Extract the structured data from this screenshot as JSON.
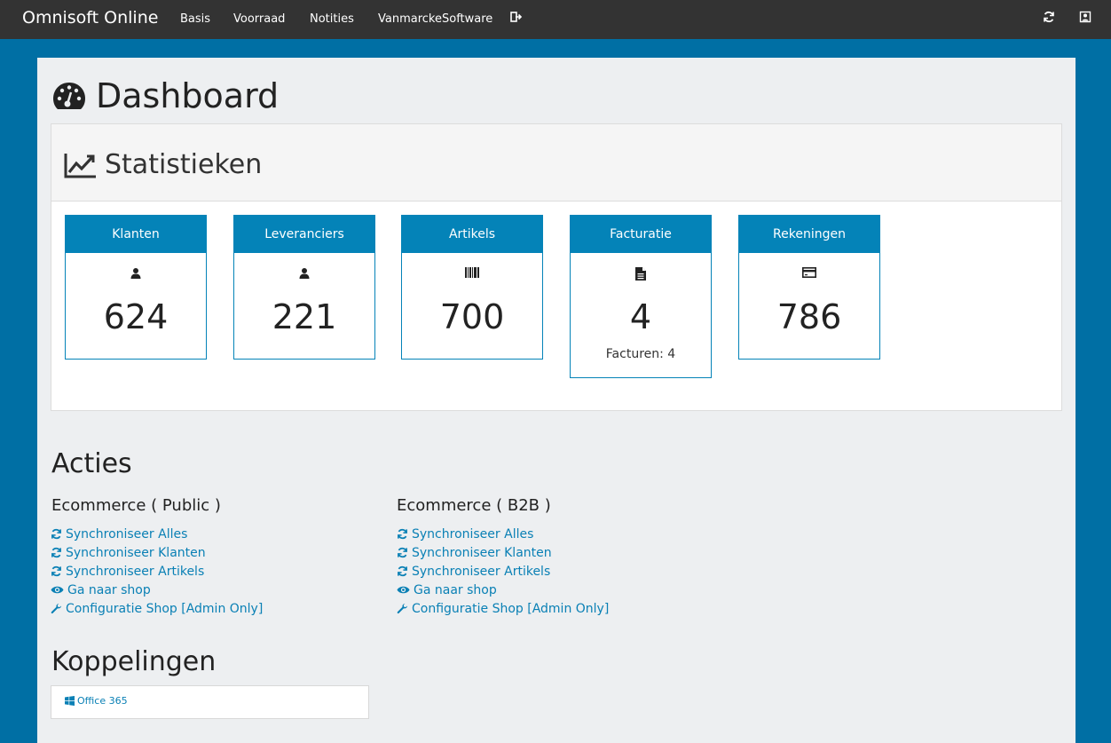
{
  "navbar": {
    "brand": "Omnisoft Online",
    "links": [
      "Basis",
      "Voorraad",
      "Notities",
      "VanmarckeSoftware"
    ]
  },
  "page": {
    "title": "Dashboard"
  },
  "stats": {
    "title": "Statistieken",
    "cards": [
      {
        "label": "Klanten",
        "icon": "user-icon",
        "value": "624"
      },
      {
        "label": "Leveranciers",
        "icon": "user-icon",
        "value": "221"
      },
      {
        "label": "Artikels",
        "icon": "barcode-icon",
        "value": "700"
      },
      {
        "label": "Facturatie",
        "icon": "file-icon",
        "value": "4",
        "sub": "Facturen: 4"
      },
      {
        "label": "Rekeningen",
        "icon": "credit-card-icon",
        "value": "786"
      }
    ]
  },
  "acties": {
    "title": "Acties",
    "groups": [
      {
        "title": "Ecommerce ( Public )",
        "links": [
          "Synchroniseer Alles",
          "Synchroniseer Klanten",
          "Synchroniseer Artikels",
          "Ga naar shop",
          "Configuratie Shop [Admin Only]"
        ]
      },
      {
        "title": "Ecommerce ( B2B )",
        "links": [
          "Synchroniseer Alles",
          "Synchroniseer Klanten",
          "Synchroniseer Artikels",
          "Ga naar shop",
          "Configuratie Shop [Admin Only]"
        ]
      }
    ]
  },
  "koppelingen": {
    "title": "Koppelingen",
    "link": "Office 365"
  },
  "colors": {
    "navbar": "#333333",
    "background": "#006fa4",
    "accent": "#0483b8",
    "link": "#0a80b5"
  }
}
